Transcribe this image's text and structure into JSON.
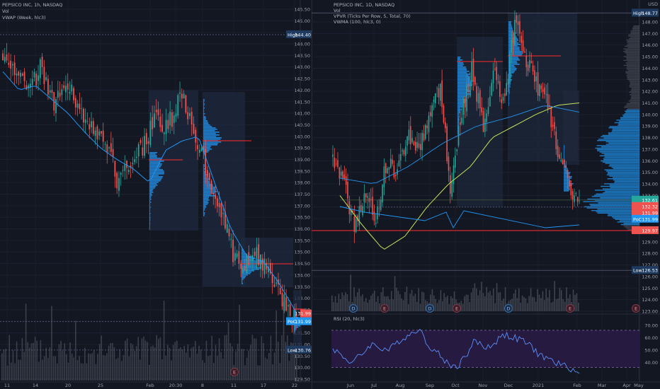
{
  "left_panel": {
    "title_lines": [
      "PEPSICO INC, 1h, NASDAQ",
      "Vol",
      "VWAP (Week, hlc3)"
    ],
    "y_ticks": [
      "145.50",
      "145.00",
      "144.50",
      "144.00",
      "143.50",
      "143.00",
      "142.50",
      "142.00",
      "141.50",
      "141.00",
      "140.50",
      "140.00",
      "139.50",
      "139.00",
      "138.50",
      "138.00",
      "137.50",
      "137.00",
      "136.50",
      "136.00",
      "135.50",
      "135.00",
      "134.50",
      "134.00",
      "133.50",
      "133.00",
      "132.50",
      "132.00",
      "131.50",
      "131.00",
      "130.50",
      "130.00",
      "129.50"
    ],
    "x_ticks": [
      "11",
      "14",
      "20",
      "25",
      "Feb",
      "20:30",
      "8",
      "11",
      "17",
      "22"
    ],
    "badges": {
      "high_label": "High",
      "high_value": "144.40",
      "last_value": "131.99",
      "poc_label": "PoC",
      "poc_value": "131.99",
      "low_label": "Low",
      "low_value": "130.76"
    },
    "event_marker": "E",
    "colors": {
      "up": "#26a69a",
      "down": "#ef5350",
      "vwap": "#2196f3",
      "profile": "#2196f3",
      "poc_line": "#ff2a2a"
    }
  },
  "right_panel": {
    "title_lines": [
      "PEPSICO INC, 1D, NASDAQ",
      "Vol",
      "VPVR (Ticks Per Row, 5, Total, 70)",
      "VWMA (100, hlc3, 0)"
    ],
    "currency": "USD",
    "y_ticks": [
      "148.00",
      "147.00",
      "146.00",
      "145.00",
      "144.00",
      "143.00",
      "142.00",
      "141.00",
      "140.00",
      "139.00",
      "138.00",
      "137.00",
      "136.00",
      "135.00",
      "134.00",
      "133.00",
      "132.00",
      "131.00",
      "130.00",
      "129.00",
      "128.00",
      "127.00",
      "126.00",
      "125.00",
      "124.00",
      "123.00"
    ],
    "x_ticks": [
      "Jun",
      "Jul",
      "Aug",
      "Sep",
      "Oct",
      "Nov",
      "Dec",
      "2021",
      "Feb",
      "Mar",
      "Apr",
      "May"
    ],
    "badges": {
      "high_label": "High",
      "high_value": "148.77",
      "v1": "132.61",
      "v2": "132.32",
      "v3": "131.99",
      "poc_label": "PoC",
      "poc_value": "131.99",
      "v4": "129.97",
      "low_label": "Low",
      "low_value": "126.53"
    },
    "event_markers": [
      "D",
      "E",
      "D",
      "E",
      "D",
      "E",
      "E"
    ],
    "rsi": {
      "label": "RSI (20, hlc3)",
      "y_ticks": [
        "70.00",
        "60.00",
        "50.00",
        "40.00"
      ]
    },
    "colors": {
      "up": "#26a69a",
      "down": "#ef5350",
      "vwma": "#c7e35a",
      "poc_line": "#ff2a2a",
      "rsi_line": "#5b8ff9",
      "rsi_band": "#2a1b46"
    }
  },
  "chart_data": [
    {
      "type": "candlestick",
      "title": "PEPSICO INC, 1h, NASDAQ",
      "ylim": [
        129.5,
        145.5
      ],
      "x": [
        "11",
        "14",
        "20",
        "25",
        "Feb",
        "20:30",
        "8",
        "11",
        "17",
        "22"
      ],
      "close_approx": [
        143.3,
        143.0,
        142.0,
        140.8,
        138.5,
        139.8,
        141.0,
        137.0,
        134.5,
        131.99
      ],
      "indicators": [
        "Vol",
        "VWAP (Week, hlc3)"
      ],
      "high": 144.4,
      "low": 130.76,
      "last": 131.99,
      "poc": 131.99
    },
    {
      "type": "candlestick",
      "title": "PEPSICO INC, 1D, NASDAQ",
      "ylim": [
        123,
        149
      ],
      "x": [
        "Jun",
        "Jul",
        "Aug",
        "Sep",
        "Oct",
        "Nov",
        "Dec",
        "2021",
        "Feb"
      ],
      "close_approx": [
        132.5,
        133.0,
        135.5,
        136.5,
        139.0,
        141.5,
        146.0,
        143.0,
        132.0
      ],
      "indicators": [
        "Vol",
        "VPVR (Ticks Per Row, 5, Total, 70)",
        "VWMA (100, hlc3, 0)",
        "RSI (20, hlc3)"
      ],
      "rsi_approx": [
        45,
        52,
        56,
        62,
        57,
        48,
        60,
        58,
        35
      ],
      "high": 148.77,
      "low": 126.53,
      "poc": 131.99
    }
  ]
}
